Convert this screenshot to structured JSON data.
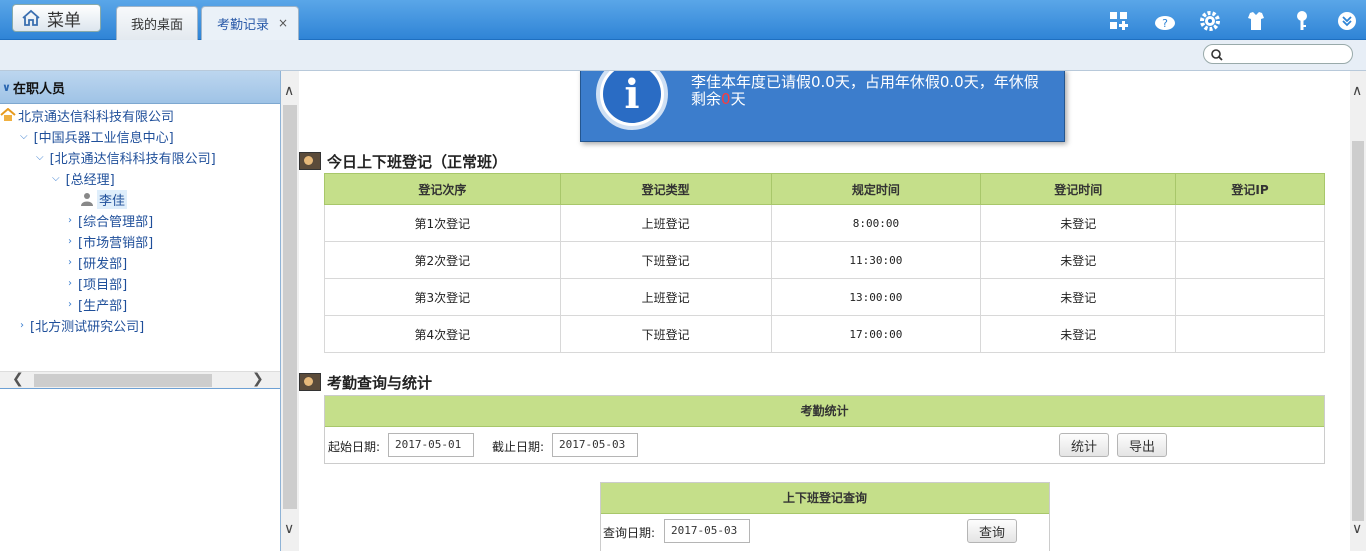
{
  "topbar": {
    "menu_label": "菜单",
    "tabs": [
      {
        "label": "我的桌面"
      },
      {
        "label": "考勤记录",
        "close": "×"
      }
    ]
  },
  "sidebar": {
    "header": "在职人员",
    "tree": [
      {
        "label": "北京通达信科科技有限公司"
      },
      {
        "label": "[中国兵器工业信息中心]"
      },
      {
        "label": "[北京通达信科科技有限公司]"
      },
      {
        "label": "[总经理]"
      },
      {
        "label": "李佳"
      },
      {
        "label": "[综合管理部]"
      },
      {
        "label": "[市场营销部]"
      },
      {
        "label": "[研发部]"
      },
      {
        "label": "[项目部]"
      },
      {
        "label": "[生产部]"
      },
      {
        "label": "[北方测试研究公司]"
      }
    ]
  },
  "notice": {
    "text_before": "李佳本年度已请假0.0天，占用年休假0.0天，年休假剩余",
    "remaining": "0",
    "text_after": "天",
    "icon": "info-icon"
  },
  "today": {
    "title": "今日上下班登记（正常班）",
    "columns": [
      "登记次序",
      "登记类型",
      "规定时间",
      "登记时间",
      "登记IP"
    ],
    "rows": [
      [
        "第1次登记",
        "上班登记",
        "8:00:00",
        "未登记",
        ""
      ],
      [
        "第2次登记",
        "下班登记",
        "11:30:00",
        "未登记",
        ""
      ],
      [
        "第3次登记",
        "上班登记",
        "13:00:00",
        "未登记",
        ""
      ],
      [
        "第4次登记",
        "下班登记",
        "17:00:00",
        "未登记",
        ""
      ]
    ]
  },
  "stats": {
    "title": "考勤查询与统计",
    "panel_title": "考勤统计",
    "start_label": "起始日期:",
    "start_value": "2017-05-01",
    "end_label": "截止日期:",
    "end_value": "2017-05-03",
    "stat_button": "统计",
    "export_button": "导出"
  },
  "query": {
    "panel_title": "上下班登记查询",
    "date_label": "查询日期:",
    "date_value": "2017-05-03",
    "query_button": "查询"
  }
}
